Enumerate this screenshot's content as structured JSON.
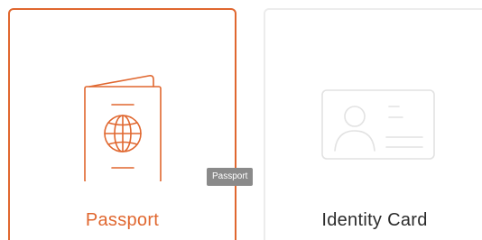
{
  "cards": [
    {
      "label": "Passport",
      "icon": "passport-icon",
      "selected": true
    },
    {
      "label": "Identity Card",
      "icon": "id-card-icon",
      "selected": false
    }
  ],
  "tooltip": {
    "text": "Passport"
  },
  "colors": {
    "accent": "#e0672f",
    "inactive_border": "#ececec",
    "inactive_icon": "#e2e2e2",
    "tooltip_bg": "#8a8a8a"
  }
}
